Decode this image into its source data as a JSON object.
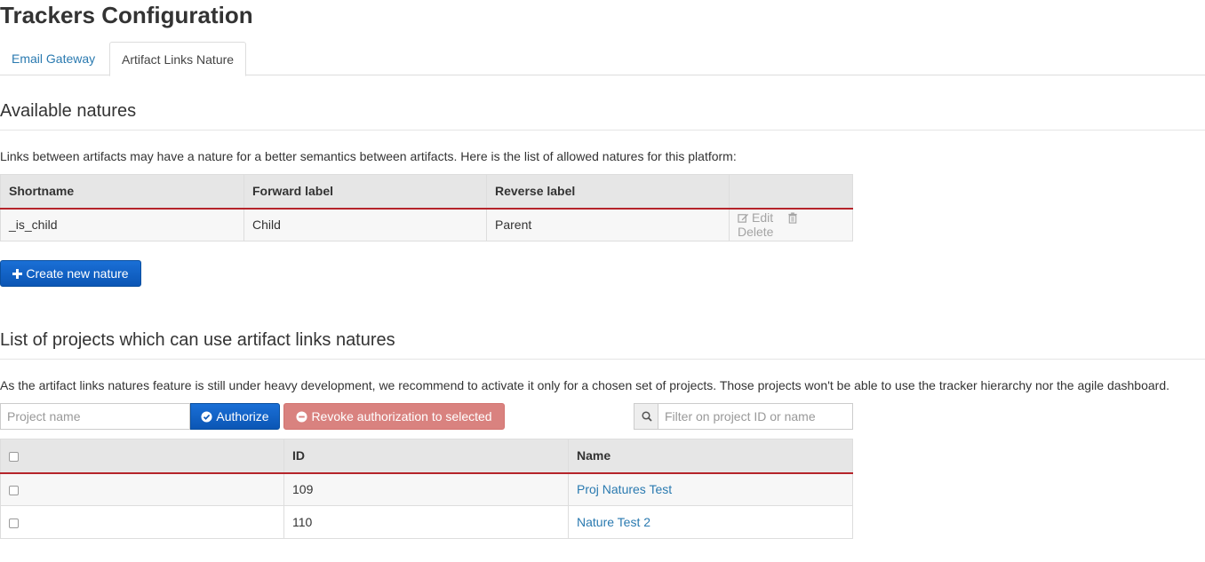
{
  "page": {
    "title": "Trackers Configuration"
  },
  "tabs": [
    {
      "label": "Email Gateway",
      "active": false
    },
    {
      "label": "Artifact Links Nature",
      "active": true
    }
  ],
  "natures": {
    "title": "Available natures",
    "description": "Links between artifacts may have a nature for a better semantics between artifacts. Here is the list of allowed natures for this platform:",
    "columns": [
      "Shortname",
      "Forward label",
      "Reverse label",
      ""
    ],
    "rows": [
      {
        "shortname": "_is_child",
        "forward": "Child",
        "reverse": "Parent",
        "edit": "Edit",
        "delete": "Delete"
      }
    ],
    "create_button": "Create new nature"
  },
  "projects": {
    "title": "List of projects which can use artifact links natures",
    "description": "As the artifact links natures feature is still under heavy development, we recommend to activate it only for a chosen set of projects. Those projects won't be able to use the tracker hierarchy nor the agile dashboard.",
    "project_placeholder": "Project name",
    "authorize_button": "Authorize",
    "revoke_button": "Revoke authorization to selected",
    "filter_placeholder": "Filter on project ID or name",
    "columns": [
      "",
      "ID",
      "Name"
    ],
    "rows": [
      {
        "id": "109",
        "name": "Proj Natures Test"
      },
      {
        "id": "110",
        "name": "Nature Test 2"
      }
    ]
  },
  "colors": {
    "primary": "#0b56b5",
    "danger": "#d9827f",
    "link": "#2a7ab0",
    "header_accent": "#b5242a"
  }
}
